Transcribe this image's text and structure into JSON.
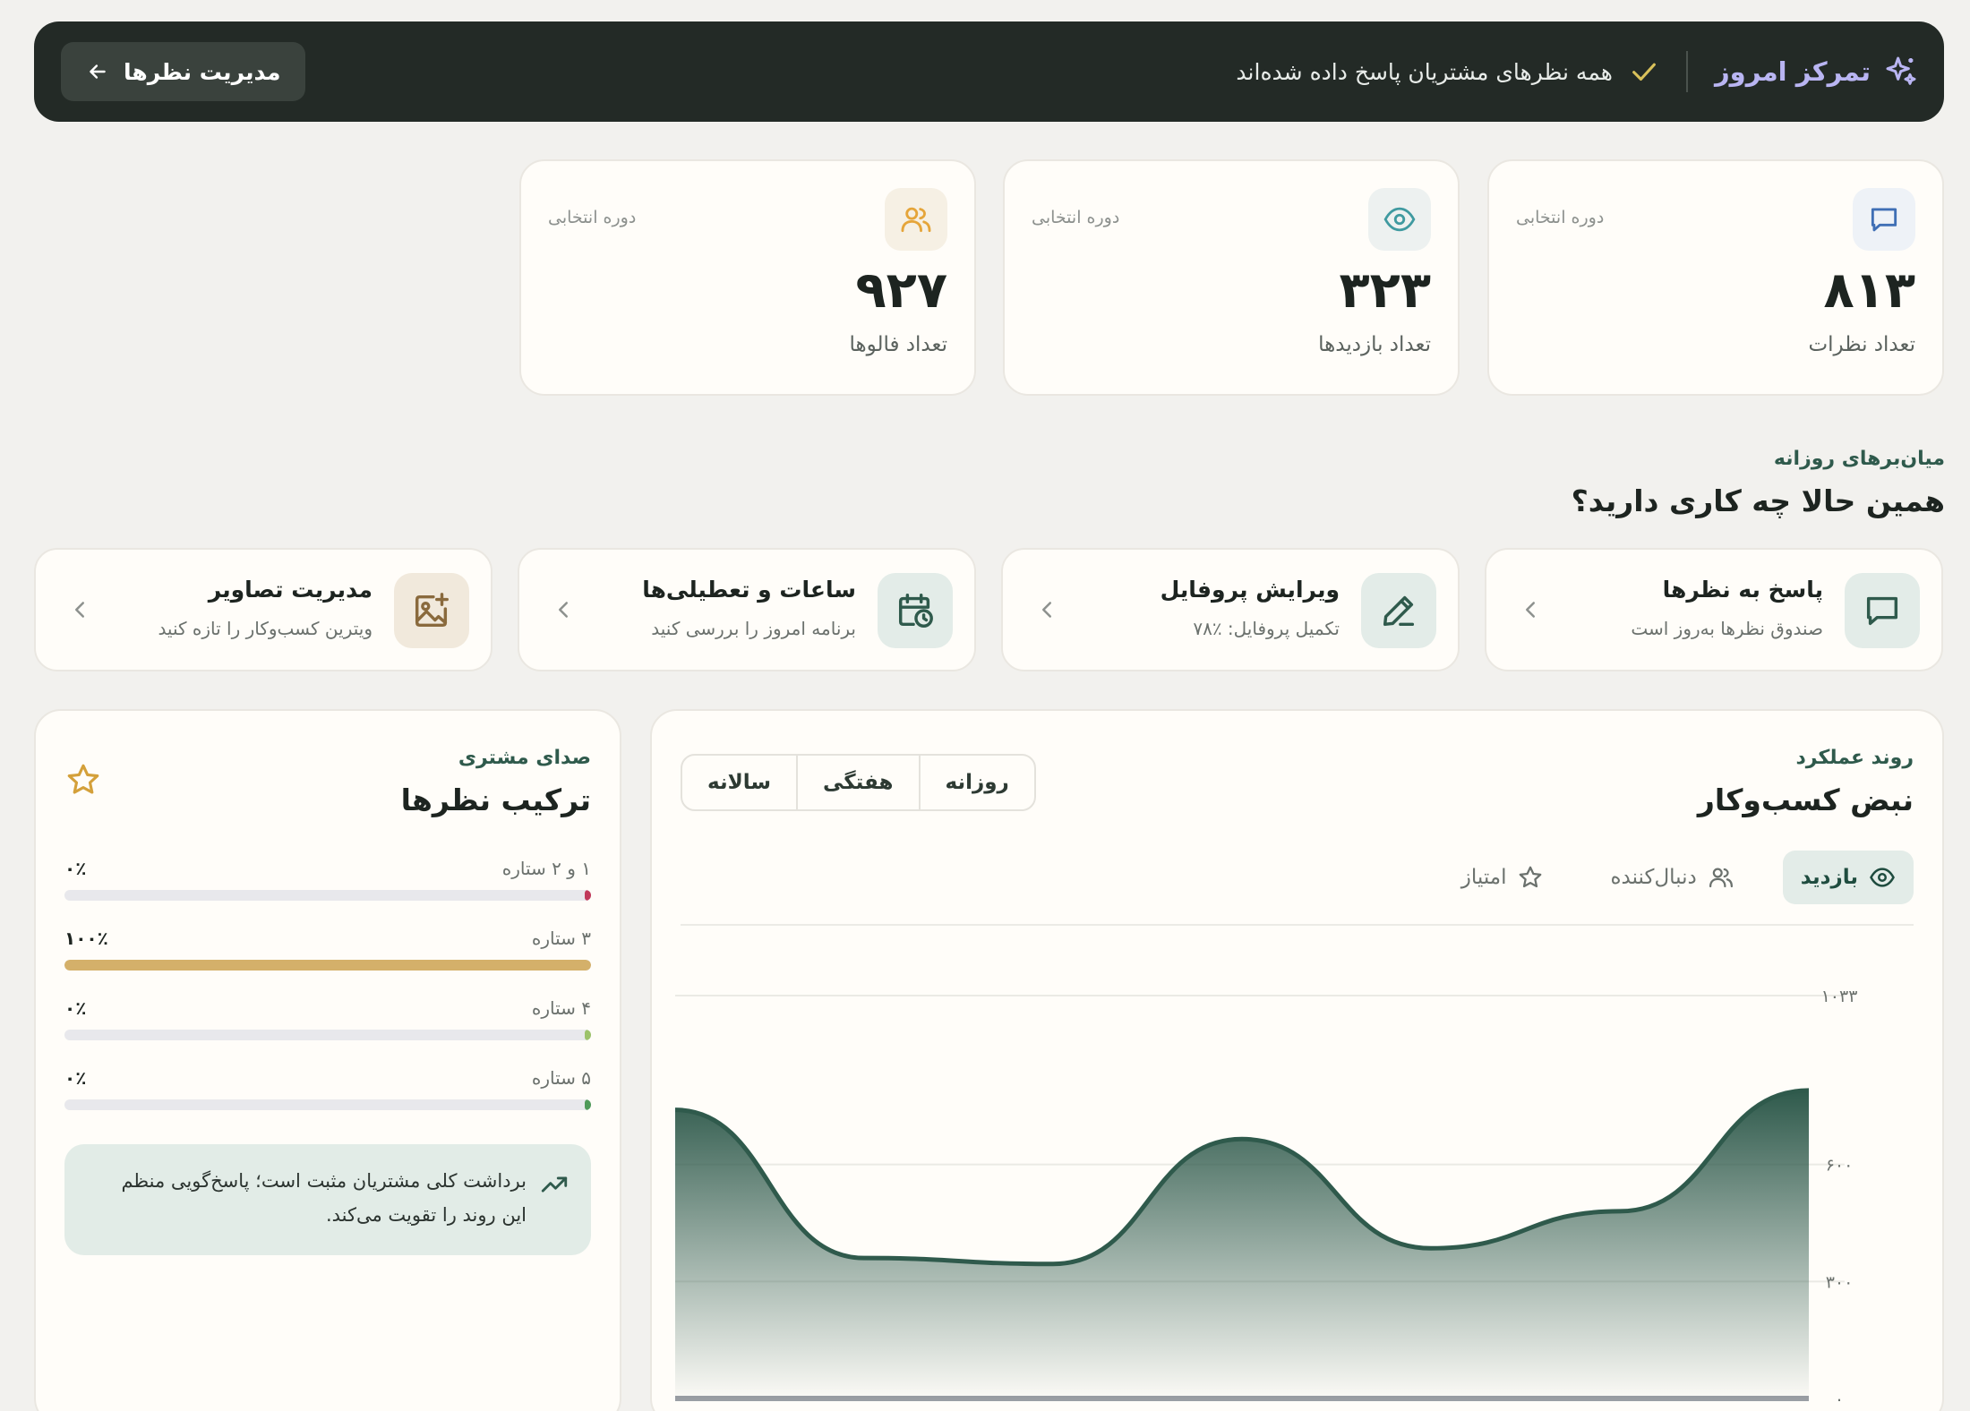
{
  "focus": {
    "title": "تمرکز امروز",
    "status": "همه نظرهای مشتریان پاسخ داده شده‌اند",
    "manage_label": "مدیریت نظرها"
  },
  "stats": [
    {
      "label": "تعداد نظرات",
      "value": "۸۱۳",
      "period": "دوره انتخابی",
      "icon": "message-icon",
      "color": "#3f6fb5"
    },
    {
      "label": "تعداد بازدیدها",
      "value": "۳۲۳",
      "period": "دوره انتخابی",
      "icon": "eye-icon",
      "color": "#3f9aa0"
    },
    {
      "label": "تعداد فالوها",
      "value": "۹۲۷",
      "period": "دوره انتخابی",
      "icon": "users-icon",
      "color": "#e5a53a"
    }
  ],
  "shortcuts": {
    "kicker": "میان‌برهای روزانه",
    "title": "همین حالا چه کاری دارید؟",
    "items": [
      {
        "name": "پاسخ به نظرها",
        "desc": "صندوق نظرها به‌روز است",
        "icon": "message-icon"
      },
      {
        "name": "ویرایش پروفایل",
        "desc": "تکمیل پروفایل: ٪۷۸",
        "icon": "pencil-icon"
      },
      {
        "name": "ساعات و تعطیلی‌ها",
        "desc": "برنامه امروز را بررسی کنید",
        "icon": "calendar-clock-icon"
      },
      {
        "name": "مدیریت تصاویر",
        "desc": "ویترین کسب‌وکار را تازه کنید",
        "icon": "image-add-icon"
      }
    ]
  },
  "performance": {
    "kicker": "روند عملکرد",
    "title": "نبض کسب‌وکار",
    "ranges": [
      "روزانه",
      "هفتگی",
      "سالانه"
    ],
    "selected_range": "روزانه",
    "metrics": [
      {
        "label": "بازدید",
        "icon": "eye-icon",
        "active": true
      },
      {
        "label": "دنبال‌کننده",
        "icon": "users-icon",
        "active": false
      },
      {
        "label": "امتیاز",
        "icon": "star-icon",
        "active": false
      }
    ]
  },
  "chart_data": {
    "type": "area",
    "y_tick_labels": [
      "۰",
      "۳۰۰",
      "۶۰۰",
      "۱۰۳۳"
    ],
    "ylim": [
      0,
      1033
    ],
    "y_ticks": [
      0,
      300,
      600,
      1033
    ],
    "x": [
      0,
      1,
      2,
      3,
      4,
      5,
      6
    ],
    "series": [
      {
        "values": [
          740,
          360,
          345,
          665,
          385,
          480,
          790
        ]
      }
    ],
    "grid": true,
    "color": "#2f5a4c"
  },
  "reviews": {
    "kicker": "صدای مشتری",
    "title": "ترکیب نظرها",
    "distribution": [
      {
        "label": "۱ و ۲ ستاره",
        "pct_text": "۰٪",
        "pct": 0,
        "color": "#c0395a"
      },
      {
        "label": "۳ ستاره",
        "pct_text": "۱۰۰٪",
        "pct": 100,
        "color": "#d4b06a"
      },
      {
        "label": "۴ ستاره",
        "pct_text": "۰٪",
        "pct": 0,
        "color": "#9cc26b"
      },
      {
        "label": "۵ ستاره",
        "pct_text": "۰٪",
        "pct": 0,
        "color": "#4f9a5a"
      }
    ],
    "insight": "برداشت کلی مشتریان مثبت است؛ پاسخ‌گویی منظم این روند را تقویت می‌کند."
  }
}
